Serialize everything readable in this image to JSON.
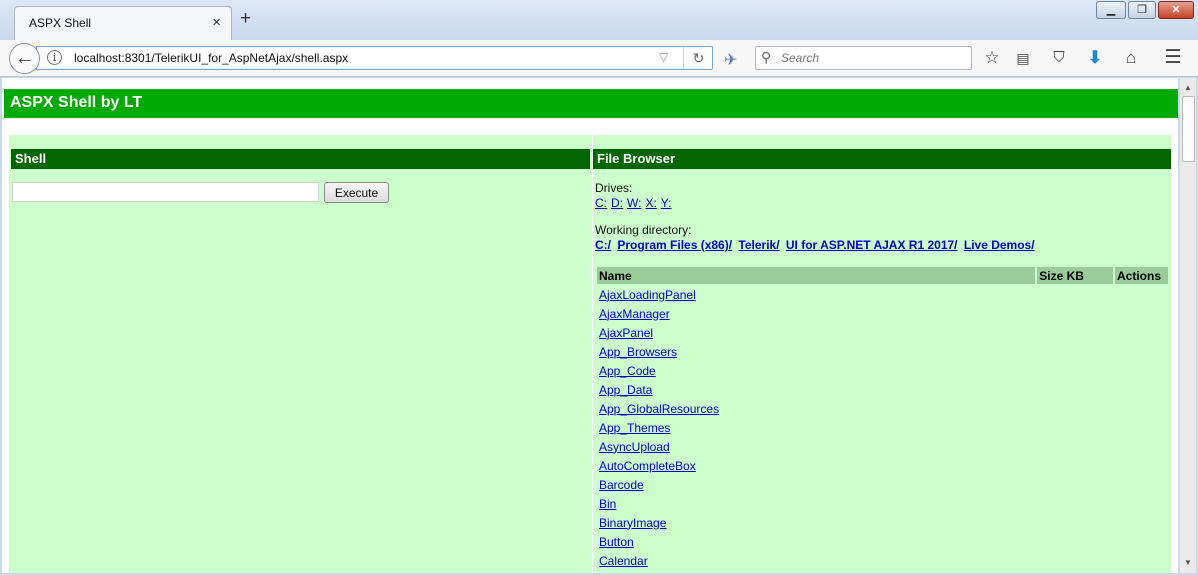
{
  "browser": {
    "tab_title": "ASPX Shell",
    "tab_close": "×",
    "new_tab": "+",
    "window_min": "▁",
    "window_max": "❐",
    "window_close": "✕",
    "url": "localhost:8301/TelerikUI_for_AspNetAjax/shell.aspx",
    "search_placeholder": "Search",
    "icons": [
      "back-icon",
      "info-icon",
      "dropdown-icon",
      "reload-icon",
      "sync-icon",
      "search-icon",
      "bookmark-star-icon",
      "reading-list-icon",
      "pocket-icon",
      "download-icon",
      "home-icon",
      "menu-icon"
    ]
  },
  "page": {
    "title": "ASPX Shell by LT",
    "shell": {
      "heading": "Shell",
      "command_value": "",
      "execute_label": "Execute"
    },
    "file_browser": {
      "heading": "File Browser",
      "drives_label": "Drives:",
      "drives": [
        "C:",
        "D:",
        "W:",
        "X:",
        "Y:"
      ],
      "working_dir_label": "Working directory:",
      "working_dir": [
        "C:/",
        "Program Files (x86)/",
        "Telerik/",
        "UI for ASP.NET AJAX R1 2017/",
        "Live Demos/"
      ],
      "columns": [
        "Name",
        "Size KB",
        "Actions"
      ],
      "rows": [
        "AjaxLoadingPanel",
        "AjaxManager",
        "AjaxPanel",
        "App_Browsers",
        "App_Code",
        "App_Data",
        "App_GlobalResources",
        "App_Themes",
        "AsyncUpload",
        "AutoCompleteBox",
        "Barcode",
        "Bin",
        "BinaryImage",
        "Button",
        "Calendar"
      ]
    }
  },
  "colors": {
    "header_green": "#00aa00",
    "panel_heading": "#006600",
    "panel_bg": "#ccffcc",
    "table_header": "#99cc99",
    "link": "#0000cc"
  }
}
